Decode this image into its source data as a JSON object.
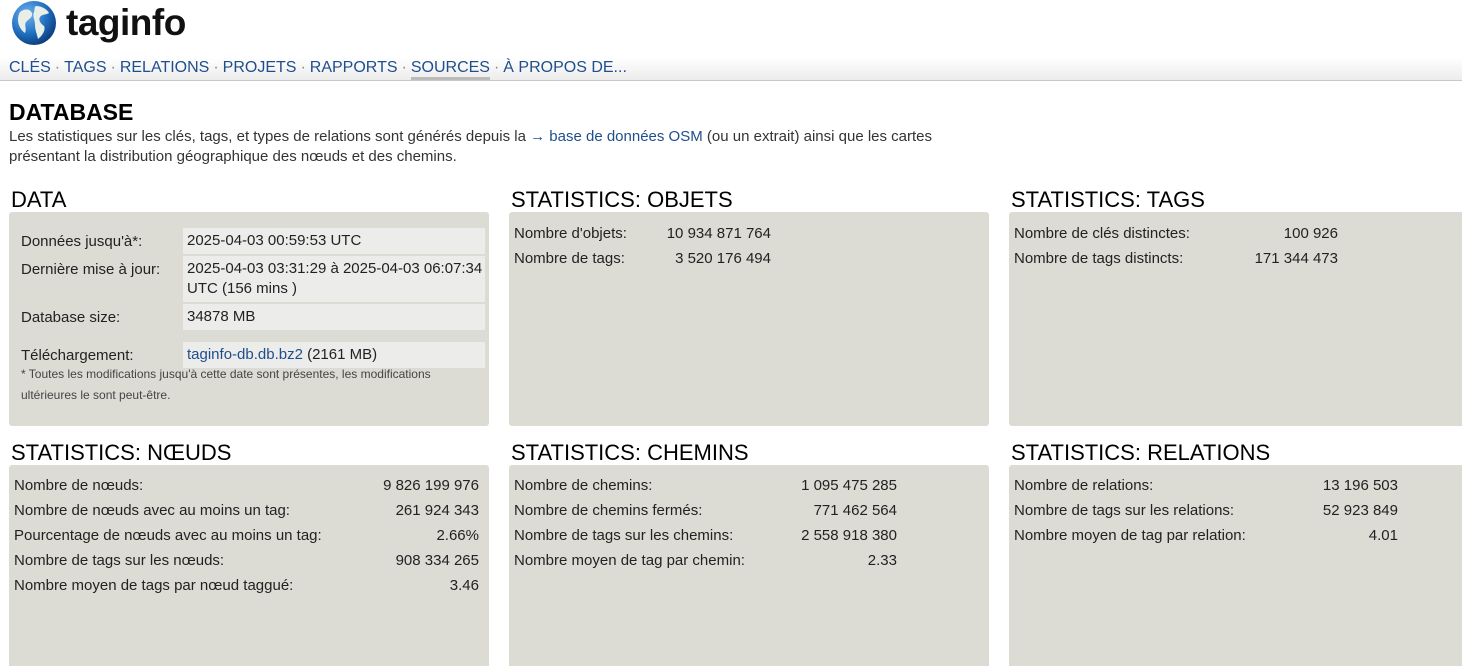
{
  "app": {
    "name": "taginfo"
  },
  "menu": [
    {
      "label": "CLÉS"
    },
    {
      "label": "TAGS"
    },
    {
      "label": "RELATIONS"
    },
    {
      "label": "PROJETS"
    },
    {
      "label": "RAPPORTS"
    },
    {
      "label": "SOURCES",
      "active": true
    },
    {
      "label": "À PROPOS DE..."
    }
  ],
  "page": {
    "title": "DATABASE",
    "intro_before": "Les statistiques sur les clés, tags, et types de relations sont générés depuis la ",
    "intro_link": "→ base de données OSM",
    "intro_after": " (ou un extrait) ainsi que les cartes présentant la distribution géographique des nœuds et des chemins."
  },
  "data_box": {
    "title": "DATA",
    "rows": [
      {
        "label": "Données jusqu'à*:",
        "value": "2025-04-03 00:59:53 UTC"
      },
      {
        "label": "Dernière mise à jour:",
        "value": "2025-04-03 03:31:29 à 2025-04-03 06:07:34 UTC (156 mins )"
      },
      {
        "label": "Database size:",
        "value": "34878 MB"
      },
      {
        "label": "Téléchargement:",
        "link": "taginfo-db.db.bz2",
        "value_after": " (2161 MB)"
      }
    ],
    "note": "* Toutes les modifications jusqu'à cette date sont présentes, les modifications ultérieures le sont peut-être."
  },
  "objets": {
    "title": "STATISTICS: OBJETS",
    "rows": [
      {
        "label": "Nombre d'objets:",
        "value": "10 934 871 764"
      },
      {
        "label": "Nombre de tags:",
        "value": "3 520 176 494"
      }
    ]
  },
  "tags": {
    "title": "STATISTICS: TAGS",
    "rows": [
      {
        "label": "Nombre de clés distinctes:",
        "value": "100 926"
      },
      {
        "label": "Nombre de tags distincts:",
        "value": "171 344 473"
      }
    ]
  },
  "noeuds": {
    "title": "STATISTICS: NŒUDS",
    "rows": [
      {
        "label": "Nombre de nœuds:",
        "value": "9 826 199 976"
      },
      {
        "label": "Nombre de nœuds avec au moins un tag:",
        "value": "261 924 343"
      },
      {
        "label": "Pourcentage de nœuds avec au moins un tag:",
        "value": "2.66%"
      },
      {
        "label": "Nombre de tags sur les nœuds:",
        "value": "908 334 265"
      },
      {
        "label": "Nombre moyen de tags par nœud taggué:",
        "value": "3.46"
      }
    ]
  },
  "chemins": {
    "title": "STATISTICS: CHEMINS",
    "rows": [
      {
        "label": "Nombre de chemins:",
        "value": "1 095 475 285"
      },
      {
        "label": "Nombre de chemins fermés:",
        "value": "771 462 564"
      },
      {
        "label": "Nombre de tags sur les chemins:",
        "value": "2 558 918 380"
      },
      {
        "label": "Nombre moyen de tag par chemin:",
        "value": "2.33"
      }
    ]
  },
  "relations": {
    "title": "STATISTICS: RELATIONS",
    "rows": [
      {
        "label": "Nombre de relations:",
        "value": "13 196 503"
      },
      {
        "label": "Nombre de tags sur les relations:",
        "value": "52 923 849"
      },
      {
        "label": "Nombre moyen de tag par relation:",
        "value": "4.01"
      }
    ]
  }
}
